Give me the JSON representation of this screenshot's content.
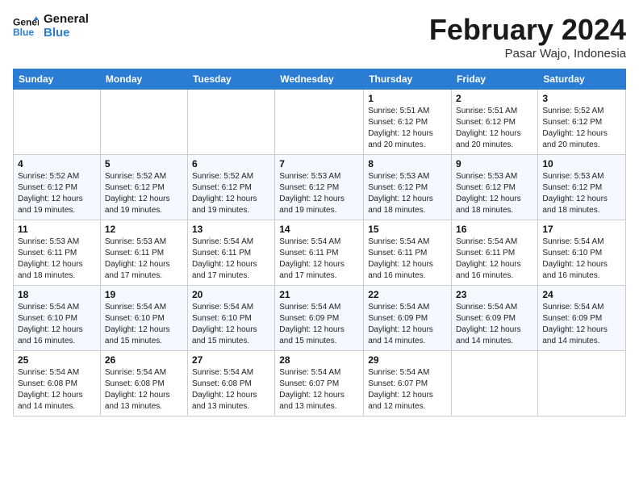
{
  "header": {
    "logo_general": "General",
    "logo_blue": "Blue",
    "month_title": "February 2024",
    "location": "Pasar Wajo, Indonesia"
  },
  "weekdays": [
    "Sunday",
    "Monday",
    "Tuesday",
    "Wednesday",
    "Thursday",
    "Friday",
    "Saturday"
  ],
  "weeks": [
    [
      {
        "day": "",
        "info": ""
      },
      {
        "day": "",
        "info": ""
      },
      {
        "day": "",
        "info": ""
      },
      {
        "day": "",
        "info": ""
      },
      {
        "day": "1",
        "info": "Sunrise: 5:51 AM\nSunset: 6:12 PM\nDaylight: 12 hours and 20 minutes."
      },
      {
        "day": "2",
        "info": "Sunrise: 5:51 AM\nSunset: 6:12 PM\nDaylight: 12 hours and 20 minutes."
      },
      {
        "day": "3",
        "info": "Sunrise: 5:52 AM\nSunset: 6:12 PM\nDaylight: 12 hours and 20 minutes."
      }
    ],
    [
      {
        "day": "4",
        "info": "Sunrise: 5:52 AM\nSunset: 6:12 PM\nDaylight: 12 hours and 19 minutes."
      },
      {
        "day": "5",
        "info": "Sunrise: 5:52 AM\nSunset: 6:12 PM\nDaylight: 12 hours and 19 minutes."
      },
      {
        "day": "6",
        "info": "Sunrise: 5:52 AM\nSunset: 6:12 PM\nDaylight: 12 hours and 19 minutes."
      },
      {
        "day": "7",
        "info": "Sunrise: 5:53 AM\nSunset: 6:12 PM\nDaylight: 12 hours and 19 minutes."
      },
      {
        "day": "8",
        "info": "Sunrise: 5:53 AM\nSunset: 6:12 PM\nDaylight: 12 hours and 18 minutes."
      },
      {
        "day": "9",
        "info": "Sunrise: 5:53 AM\nSunset: 6:12 PM\nDaylight: 12 hours and 18 minutes."
      },
      {
        "day": "10",
        "info": "Sunrise: 5:53 AM\nSunset: 6:12 PM\nDaylight: 12 hours and 18 minutes."
      }
    ],
    [
      {
        "day": "11",
        "info": "Sunrise: 5:53 AM\nSunset: 6:11 PM\nDaylight: 12 hours and 18 minutes."
      },
      {
        "day": "12",
        "info": "Sunrise: 5:53 AM\nSunset: 6:11 PM\nDaylight: 12 hours and 17 minutes."
      },
      {
        "day": "13",
        "info": "Sunrise: 5:54 AM\nSunset: 6:11 PM\nDaylight: 12 hours and 17 minutes."
      },
      {
        "day": "14",
        "info": "Sunrise: 5:54 AM\nSunset: 6:11 PM\nDaylight: 12 hours and 17 minutes."
      },
      {
        "day": "15",
        "info": "Sunrise: 5:54 AM\nSunset: 6:11 PM\nDaylight: 12 hours and 16 minutes."
      },
      {
        "day": "16",
        "info": "Sunrise: 5:54 AM\nSunset: 6:11 PM\nDaylight: 12 hours and 16 minutes."
      },
      {
        "day": "17",
        "info": "Sunrise: 5:54 AM\nSunset: 6:10 PM\nDaylight: 12 hours and 16 minutes."
      }
    ],
    [
      {
        "day": "18",
        "info": "Sunrise: 5:54 AM\nSunset: 6:10 PM\nDaylight: 12 hours and 16 minutes."
      },
      {
        "day": "19",
        "info": "Sunrise: 5:54 AM\nSunset: 6:10 PM\nDaylight: 12 hours and 15 minutes."
      },
      {
        "day": "20",
        "info": "Sunrise: 5:54 AM\nSunset: 6:10 PM\nDaylight: 12 hours and 15 minutes."
      },
      {
        "day": "21",
        "info": "Sunrise: 5:54 AM\nSunset: 6:09 PM\nDaylight: 12 hours and 15 minutes."
      },
      {
        "day": "22",
        "info": "Sunrise: 5:54 AM\nSunset: 6:09 PM\nDaylight: 12 hours and 14 minutes."
      },
      {
        "day": "23",
        "info": "Sunrise: 5:54 AM\nSunset: 6:09 PM\nDaylight: 12 hours and 14 minutes."
      },
      {
        "day": "24",
        "info": "Sunrise: 5:54 AM\nSunset: 6:09 PM\nDaylight: 12 hours and 14 minutes."
      }
    ],
    [
      {
        "day": "25",
        "info": "Sunrise: 5:54 AM\nSunset: 6:08 PM\nDaylight: 12 hours and 14 minutes."
      },
      {
        "day": "26",
        "info": "Sunrise: 5:54 AM\nSunset: 6:08 PM\nDaylight: 12 hours and 13 minutes."
      },
      {
        "day": "27",
        "info": "Sunrise: 5:54 AM\nSunset: 6:08 PM\nDaylight: 12 hours and 13 minutes."
      },
      {
        "day": "28",
        "info": "Sunrise: 5:54 AM\nSunset: 6:07 PM\nDaylight: 12 hours and 13 minutes."
      },
      {
        "day": "29",
        "info": "Sunrise: 5:54 AM\nSunset: 6:07 PM\nDaylight: 12 hours and 12 minutes."
      },
      {
        "day": "",
        "info": ""
      },
      {
        "day": "",
        "info": ""
      }
    ]
  ]
}
